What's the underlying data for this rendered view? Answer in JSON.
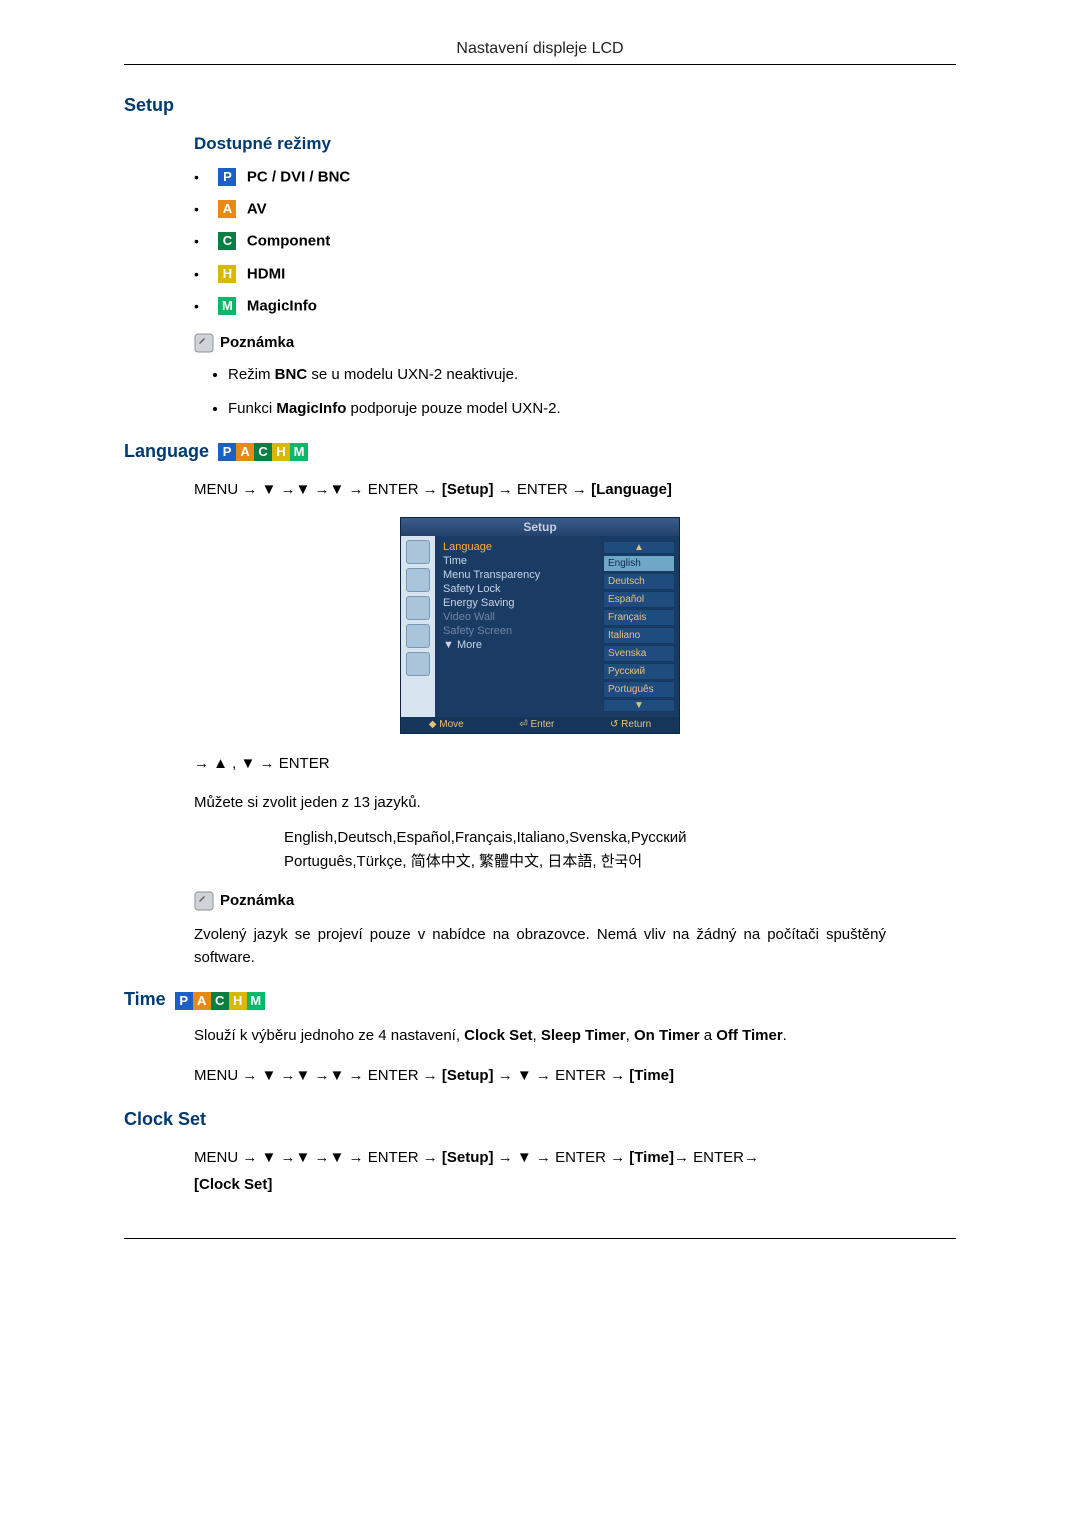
{
  "header": {
    "title": "Nastavení displeje LCD"
  },
  "setup": {
    "title": "Setup",
    "modes_title": "Dostupné režimy",
    "modes": [
      {
        "badge": "P",
        "cls": "badge-p",
        "label": "PC / DVI / BNC"
      },
      {
        "badge": "A",
        "cls": "badge-a",
        "label": "AV"
      },
      {
        "badge": "C",
        "cls": "badge-c",
        "label": "Component"
      },
      {
        "badge": "H",
        "cls": "badge-h",
        "label": "HDMI"
      },
      {
        "badge": "M",
        "cls": "badge-m",
        "label": "MagicInfo"
      }
    ],
    "note_label": "Poznámka",
    "note_items": {
      "a_pre": "Režim ",
      "a_bold": "BNC",
      "a_post": " se u modelu UXN-2 neaktivuje.",
      "b_pre": "Funkci ",
      "b_bold": "MagicInfo",
      "b_post": " podporuje pouze model UXN-2."
    }
  },
  "language": {
    "title": "Language",
    "nav1": {
      "p1": "MENU → ▼ →▼ →▼ → ENTER → ",
      "b1": "[Setup]",
      "p2": " → ENTER → ",
      "b2": "[Language]"
    },
    "nav2": "→ ▲ , ▼ → ENTER",
    "intro": "Můžete si zvolit jeden z 13 jazyků.",
    "langs_line1": "English,Deutsch,Español,Français,Italiano,Svenska,Русский",
    "langs_line2": "Português,Türkçe, 简体中文,  繁體中文, 日本語, 한국어",
    "note_label": "Poznámka",
    "note_body": "Zvolený jazyk se projeví pouze v nabídce na obrazovce. Nemá vliv na žádný na počítači spuštěný software."
  },
  "time": {
    "title": "Time",
    "intro_pre": "Slouží k výběru jednoho ze 4 nastavení, ",
    "b1": "Clock Set",
    "s1": ", ",
    "b2": "Sleep Timer",
    "s2": ", ",
    "b3": "On Timer",
    "s3": " a ",
    "b4": "Off Timer",
    "s4": ".",
    "nav": {
      "p1": "MENU → ▼ →▼ →▼ → ENTER → ",
      "b1": "[Setup]",
      "p2": " → ▼ → ENTER → ",
      "b2": "[Time]"
    }
  },
  "clockset": {
    "title": "Clock Set",
    "nav": {
      "p1": "MENU → ▼ →▼ →▼ → ENTER → ",
      "b1": "[Setup]",
      "p2": " → ▼ → ENTER → ",
      "b2": "[Time]",
      "p3": "→ ENTER→ ",
      "b3": "[Clock Set]"
    }
  },
  "osd": {
    "title": "Setup",
    "menu": {
      "language": "Language",
      "time": "Time",
      "transparency": "Menu Transparency",
      "safety_lock": "Safety Lock",
      "energy": "Energy Saving",
      "video_wall": "Video Wall",
      "safety_screen": "Safety Screen",
      "more": "▼ More"
    },
    "langs": {
      "up": "▲",
      "l1": "English",
      "l2": "Deutsch",
      "l3": "Español",
      "l4": "Français",
      "l5": "Italiano",
      "l6": "Svenska",
      "l7": "Русский",
      "l8": "Português",
      "down": "▼"
    },
    "foot": {
      "move": "◆ Move",
      "enter": "⏎ Enter",
      "ret": "↺ Return"
    }
  }
}
